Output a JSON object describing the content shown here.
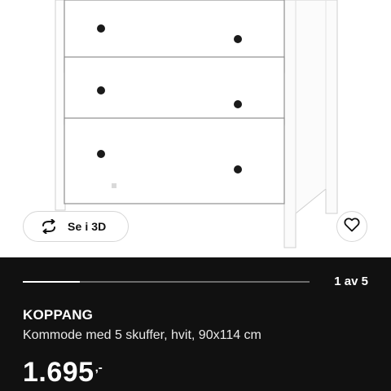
{
  "media": {
    "view_3d_label": "Se i 3D",
    "view_3d_icon": "rotate-arrows-icon",
    "favorite_icon": "heart-icon"
  },
  "gallery": {
    "pagination_text": "1 av 5",
    "progress_fraction": 0.2
  },
  "product": {
    "name": "KOPPANG",
    "description": "Kommode med 5 skuffer, hvit, 90x114 cm",
    "price_main": "1.695",
    "price_suffix": ",-"
  },
  "colors": {
    "panel_background": "#111111",
    "text_primary": "#ffffff",
    "furniture": "#ffffff"
  }
}
